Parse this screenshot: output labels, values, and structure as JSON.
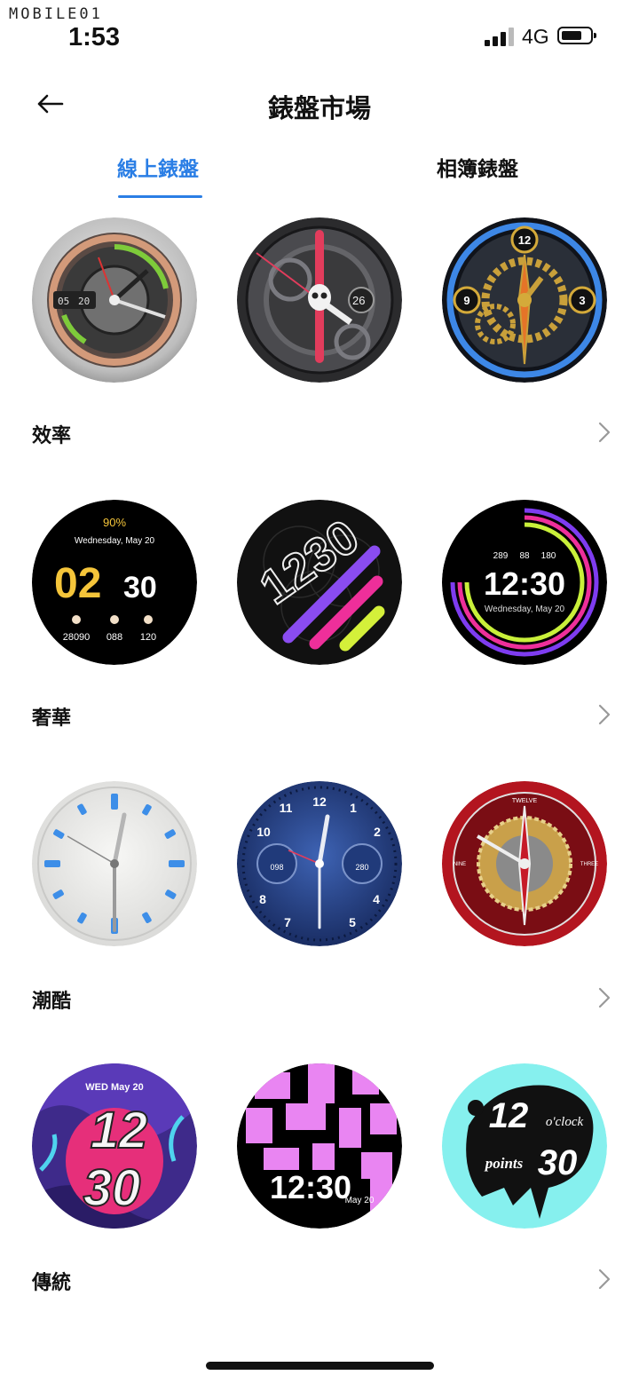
{
  "status_bar": {
    "watermark": "MOBILE01",
    "time": "1:53",
    "network": "4G"
  },
  "header": {
    "title": "錶盤市場"
  },
  "tabs": [
    {
      "label": "線上錶盤",
      "active": true
    },
    {
      "label": "相簿錶盤",
      "active": false
    }
  ],
  "colors": {
    "accent": "#2a7ee5",
    "background": "#ffffff",
    "text": "#111111"
  },
  "featured": {
    "faces": [
      {
        "name": "silver-mechanical",
        "date_a": "05",
        "date_b": "20"
      },
      {
        "name": "skull-mechanical",
        "day": "26"
      },
      {
        "name": "golden-gears",
        "n12": "12",
        "n3": "3",
        "n9": "9"
      }
    ]
  },
  "categories": [
    {
      "label": "效率",
      "faces": [
        {
          "battery": "90%",
          "date": "Wednesday, May 20",
          "hour": "02",
          "minute": "30",
          "steps": "28090",
          "heart": "088",
          "calories": "120"
        },
        {
          "time": "1230"
        },
        {
          "counts": [
            "289",
            "88",
            "180"
          ],
          "time": "12:30",
          "date": "Wednesday, May 20"
        }
      ]
    },
    {
      "label": "奢華",
      "faces": [
        {
          "style": "white-analog"
        },
        {
          "numerals": [
            "12",
            "1",
            "2",
            "4",
            "5",
            "7",
            "8",
            "10",
            "11"
          ],
          "left_dial": "098",
          "right_dial": "280"
        },
        {
          "brand_top": "TWELVE",
          "brand_left": "NINE",
          "brand_right": "THREE"
        }
      ]
    },
    {
      "label": "潮酷",
      "faces": [
        {
          "date": "WED May 20",
          "hour": "12",
          "minute": "30"
        },
        {
          "time": "12:30",
          "date": "May 20"
        },
        {
          "hour": "12",
          "oclock": "o'clock",
          "points": "points",
          "minute": "30"
        }
      ]
    },
    {
      "label": "傳統",
      "faces": []
    }
  ]
}
